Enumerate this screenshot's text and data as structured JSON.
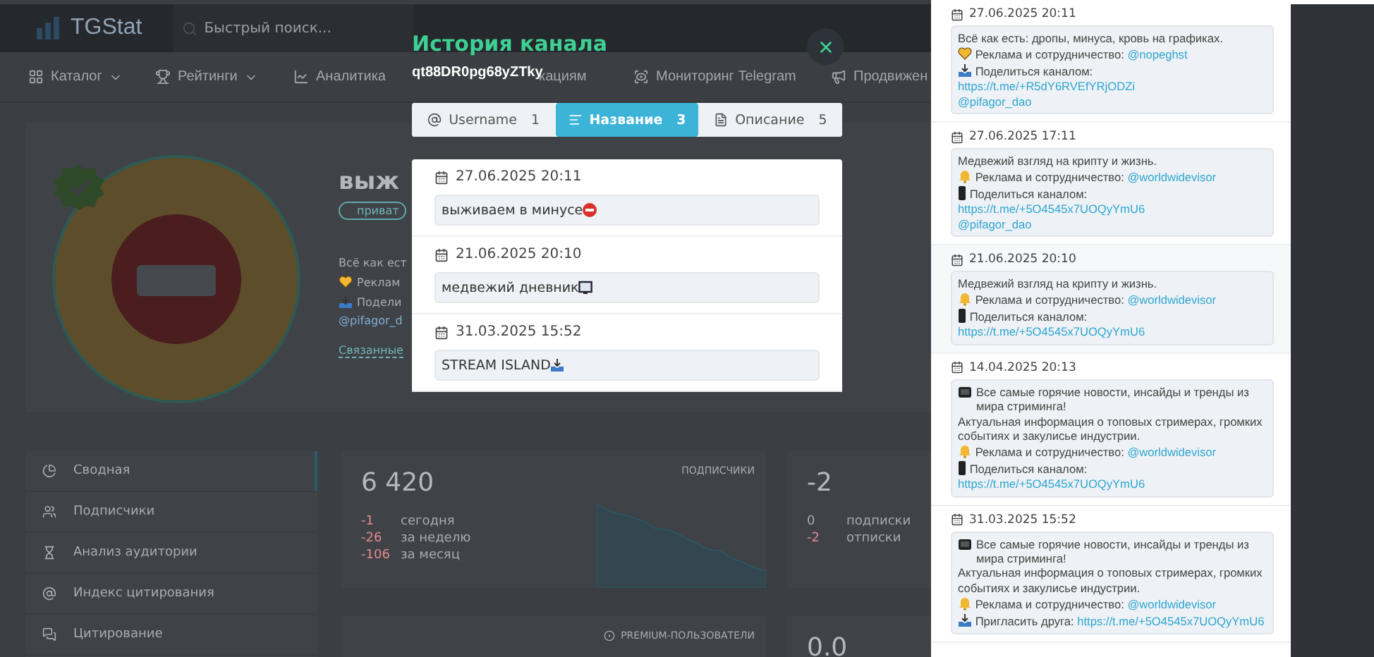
{
  "header": {
    "logo": "TGStat",
    "search_placeholder": "Быстрый поиск..."
  },
  "nav": [
    {
      "label": "Каталог",
      "kind": "catalog",
      "caret": true
    },
    {
      "label": "Рейтинги",
      "kind": "ratings",
      "caret": true
    },
    {
      "label": "Аналитика",
      "kind": "analytics",
      "caret": false
    },
    {
      "label": "кациям",
      "kind": "none",
      "caret": false
    },
    {
      "label": "Мониторинг Telegram",
      "kind": "monitor",
      "caret": false
    },
    {
      "label": "Продвижен",
      "kind": "promo",
      "caret": false
    }
  ],
  "channel": {
    "title": "выж",
    "badge": "приват",
    "lines": [
      {
        "kind": "plain",
        "text": "Всё как ест"
      },
      {
        "kind": "heart",
        "text": "Реклам"
      },
      {
        "kind": "tray",
        "text": "Подели"
      },
      {
        "kind": "link",
        "text": "@pifagor_d"
      }
    ],
    "related": "Связанные"
  },
  "sidebar": [
    {
      "label": "Сводная",
      "kind": "summary",
      "selected": true
    },
    {
      "label": "Подписчики",
      "kind": "users",
      "selected": false
    },
    {
      "label": "Анализ аудитории",
      "kind": "audience",
      "selected": false
    },
    {
      "label": "Индекс цитирования",
      "kind": "index",
      "selected": false
    },
    {
      "label": "Цитирование",
      "kind": "quotes",
      "selected": false
    }
  ],
  "subscribers_card": {
    "value": "6 420",
    "label": "ПОДПИСЧИКИ",
    "changes": [
      {
        "value": "-1",
        "period": "сегодня"
      },
      {
        "value": "-26",
        "period": "за неделю"
      },
      {
        "value": "-106",
        "period": "за месяц"
      }
    ]
  },
  "flow_card": {
    "value": "-2",
    "rows": [
      {
        "value": "0",
        "label": "подписки",
        "negative": false
      },
      {
        "value": "-2",
        "label": "отписки",
        "negative": true
      }
    ]
  },
  "premium_card": {
    "label": "PREMIUM-ПОЛЬЗОВАТЕЛИ"
  },
  "rating_card": {
    "value": "0.0"
  },
  "modal": {
    "title": "История канала",
    "channel_id": "qt88DR0pg68yZTky",
    "tabs": [
      {
        "label": "Username",
        "count": "1",
        "kind": "at",
        "selected": false
      },
      {
        "label": "Название",
        "count": "3",
        "kind": "lines",
        "selected": true
      },
      {
        "label": "Описание",
        "count": "5",
        "kind": "doc",
        "selected": false
      }
    ],
    "entries": [
      {
        "date": "27.06.2025 20:11",
        "text": "выживаем в минусе",
        "kind": "no-entry"
      },
      {
        "date": "21.06.2025 20:10",
        "text": "медвежий дневник",
        "kind": "monitor"
      },
      {
        "date": "31.03.2025 15:52",
        "text": "STREAM ISLAND",
        "kind": "tray"
      }
    ]
  },
  "description_history": [
    {
      "date": "27.06.2025 20:11",
      "lines": [
        {
          "kind": "plain",
          "text": "Всё как есть: дропы, минуса, кровь на графиках."
        },
        {
          "kind": "heart",
          "text": "Реклама и сотрудничество:",
          "link": "@nopeghst"
        },
        {
          "kind": "tray",
          "text": "Поделиться каналом:",
          "link": "https://t.me/+R5dY6RVEfYRjODZi"
        },
        {
          "kind": "link",
          "link": "@pifagor_dao"
        }
      ]
    },
    {
      "date": "27.06.2025 17:11",
      "lines": [
        {
          "kind": "plain",
          "text": "Медвежий взгляд на крипту и жизнь."
        },
        {
          "kind": "bell",
          "text": "Реклама и сотрудничество:",
          "link": "@worldwidevisor"
        },
        {
          "kind": "phone",
          "text": "Поделиться каналом:",
          "link": "https://t.me/+5O4545x7UOQyYmU6"
        },
        {
          "kind": "link",
          "link": "@pifagor_dao"
        }
      ]
    },
    {
      "date": "21.06.2025 20:10",
      "lines": [
        {
          "kind": "plain",
          "text": "Медвежий взгляд на крипту и жизнь."
        },
        {
          "kind": "bell",
          "text": "Реклама и сотрудничество:",
          "link": "@worldwidevisor"
        },
        {
          "kind": "phone",
          "text": "Поделиться каналом:",
          "link": "https://t.me/+5O4545x7UOQyYmU6"
        }
      ]
    },
    {
      "date": "14.04.2025 20:13",
      "lines": [
        {
          "kind": "tv",
          "text": "Все самые горячие новости, инсайды и тренды из мира стриминга!"
        },
        {
          "kind": "plain",
          "text": "Актуальная информация о топовых стримерах, громких событиях и закулисье индустрии."
        },
        {
          "kind": "bell",
          "text": "Реклама и сотрудничество:",
          "link": "@worldwidevisor"
        },
        {
          "kind": "phone",
          "text": "Поделиться каналом:",
          "link": "https://t.me/+5O4545x7UOQyYmU6"
        }
      ]
    },
    {
      "date": "31.03.2025 15:52",
      "lines": [
        {
          "kind": "tv",
          "text": "Все самые горячие новости, инсайды и тренды из мира стриминга!"
        },
        {
          "kind": "plain",
          "text": "Актуальная информация о топовых стримерах, громких событиях и закулисье индустрии."
        },
        {
          "kind": "bell",
          "text": "Реклама и сотрудничество:",
          "link": "@worldwidevisor"
        },
        {
          "kind": "tray",
          "text": "Пригласить друга:",
          "link": "https://t.me/+5O4545x7UOQyYmU6"
        }
      ]
    }
  ]
}
